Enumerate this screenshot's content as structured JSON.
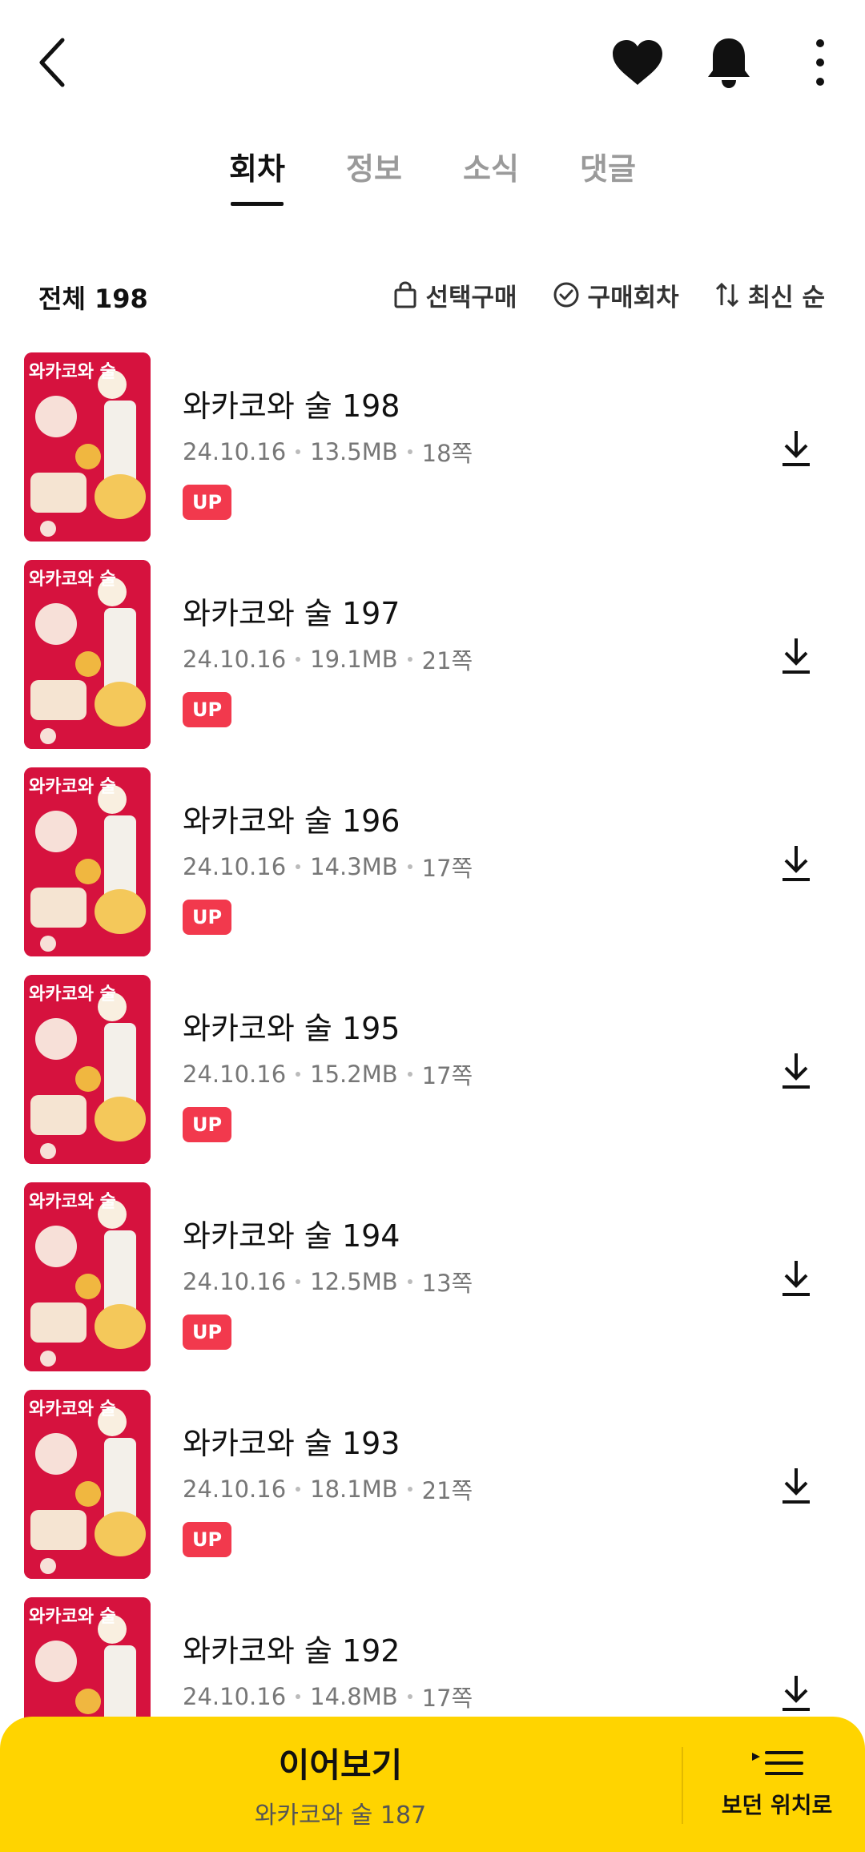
{
  "tabs": [
    {
      "label": "회차",
      "active": true
    },
    {
      "label": "정보",
      "active": false
    },
    {
      "label": "소식",
      "active": false
    },
    {
      "label": "댓글",
      "active": false
    }
  ],
  "summary": {
    "total_label": "전체 198"
  },
  "filters": {
    "select_purchase": "선택구매",
    "purchased": "구매회차",
    "sort": "최신 순"
  },
  "episodes": [
    {
      "title": "와카코와 술 198",
      "date": "24.10.16",
      "size": "13.5MB",
      "pages": "18쪽",
      "badge": "UP"
    },
    {
      "title": "와카코와 술 197",
      "date": "24.10.16",
      "size": "19.1MB",
      "pages": "21쪽",
      "badge": "UP"
    },
    {
      "title": "와카코와 술 196",
      "date": "24.10.16",
      "size": "14.3MB",
      "pages": "17쪽",
      "badge": "UP"
    },
    {
      "title": "와카코와 술 195",
      "date": "24.10.16",
      "size": "15.2MB",
      "pages": "17쪽",
      "badge": "UP"
    },
    {
      "title": "와카코와 술 194",
      "date": "24.10.16",
      "size": "12.5MB",
      "pages": "13쪽",
      "badge": "UP"
    },
    {
      "title": "와카코와 술 193",
      "date": "24.10.16",
      "size": "18.1MB",
      "pages": "21쪽",
      "badge": "UP"
    },
    {
      "title": "와카코와 술 192",
      "date": "24.10.16",
      "size": "14.8MB",
      "pages": "17쪽",
      "badge": ""
    }
  ],
  "thumbnail_text": "와카코와 술",
  "bottom_bar": {
    "resume_title": "이어보기",
    "resume_episode": "와카코와 술 187",
    "position_label": "보던 위치로"
  },
  "colors": {
    "accent": "#ffd400",
    "badge": "#f2394d",
    "cover": "#d6123e"
  },
  "icons": [
    "back-arrow-icon",
    "heart-icon",
    "bell-icon",
    "more-vertical-icon",
    "bag-icon",
    "check-circle-icon",
    "sort-icon",
    "download-icon",
    "play-list-icon"
  ]
}
